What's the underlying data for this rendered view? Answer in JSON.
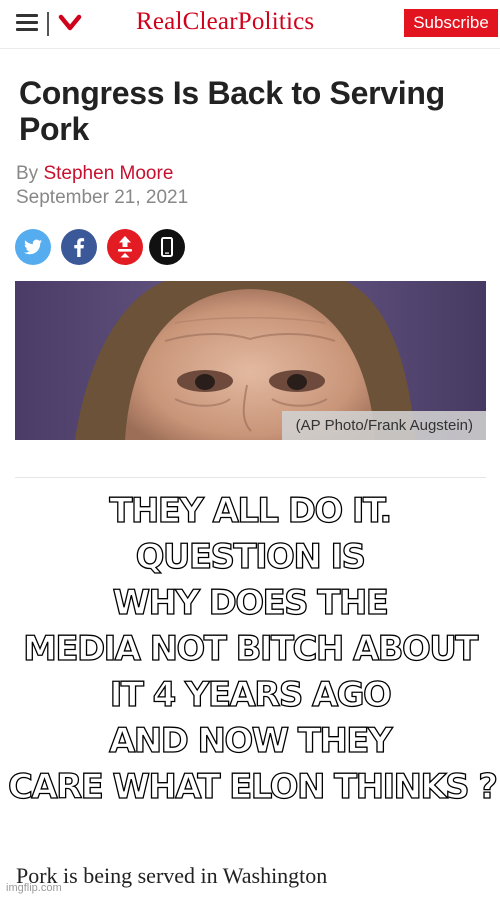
{
  "header": {
    "menu_icon": "hamburger-menu-icon",
    "dropdown_icon": "chevron-down-icon",
    "logo_text": "RealClearPolitics",
    "subscribe_label": "Subscribe",
    "brand_color": "#e2141f"
  },
  "article": {
    "headline": "Congress Is Back to Serving Pork",
    "byline_prefix": "By",
    "author": "Stephen Moore",
    "date": "September 21, 2021",
    "share_icons": [
      "twitter-icon",
      "facebook-icon",
      "reddit-icon",
      "phone-icon"
    ],
    "photo_caption": "(AP Photo/Frank Augstein)",
    "body_start": "Pork is being served in Washington"
  },
  "meme": {
    "lines": [
      "THEY ALL DO IT.",
      "QUESTION IS",
      "WHY DOES THE",
      "MEDIA NOT BITCH ABOUT",
      "IT 4 YEARS AGO",
      "AND NOW THEY",
      "CARE WHAT ELON THINKS ?"
    ]
  },
  "watermark": "imgflip.com"
}
